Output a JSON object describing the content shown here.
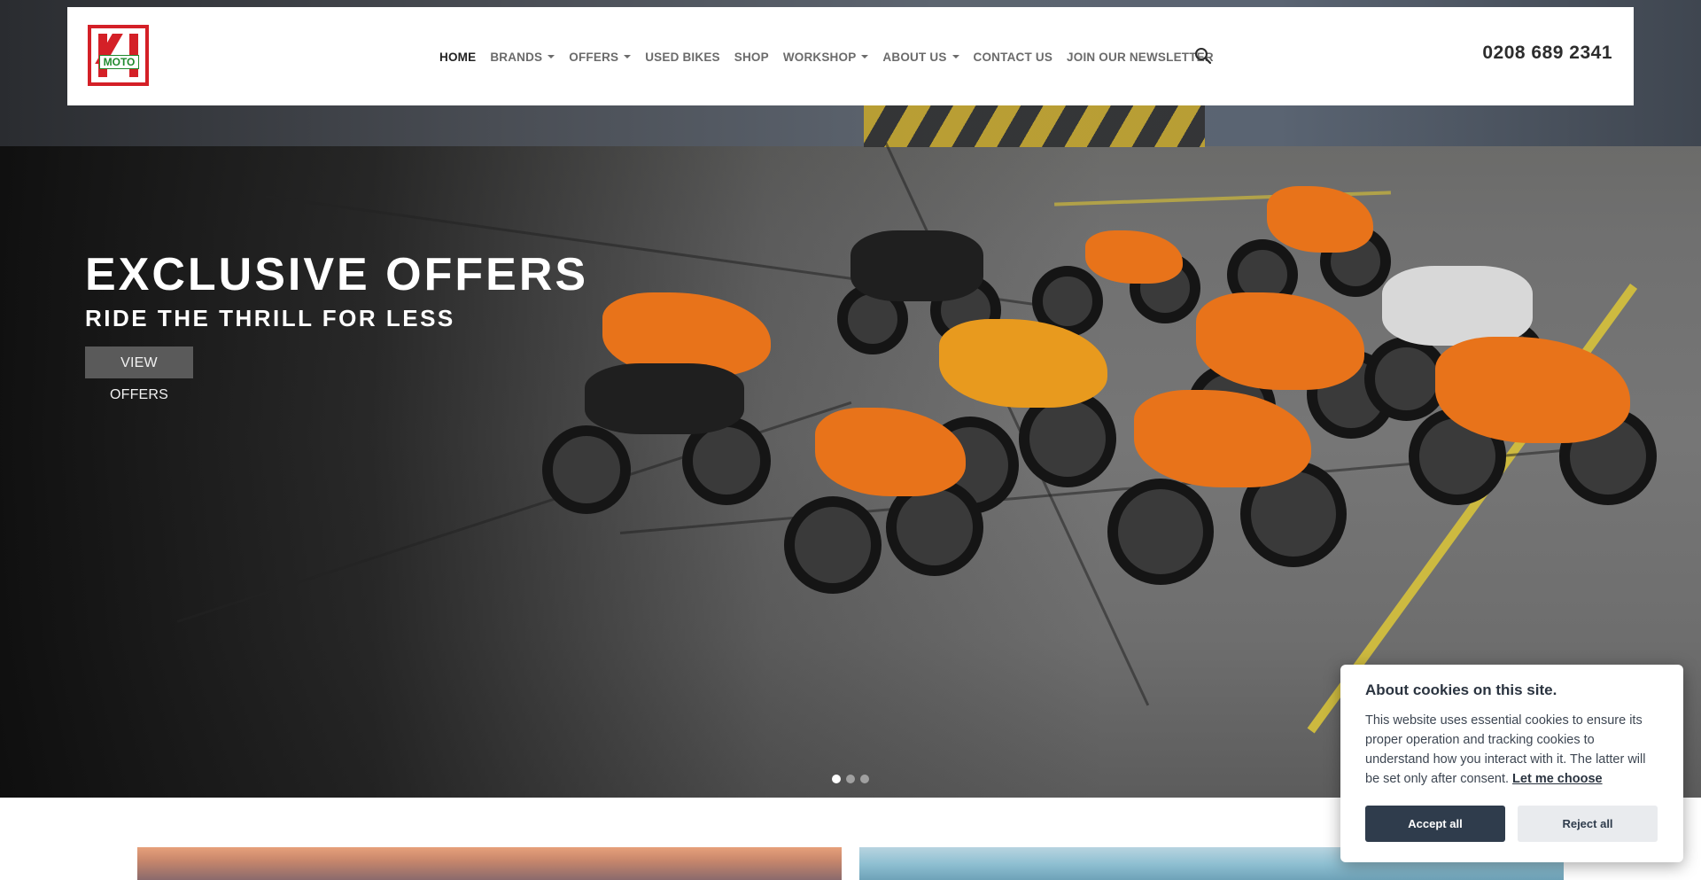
{
  "header": {
    "logo_text": "MOTO",
    "nav": [
      {
        "label": "HOME",
        "active": true,
        "dropdown": false
      },
      {
        "label": "BRANDS",
        "active": false,
        "dropdown": true
      },
      {
        "label": "OFFERS",
        "active": false,
        "dropdown": true
      },
      {
        "label": "USED BIKES",
        "active": false,
        "dropdown": false
      },
      {
        "label": "SHOP",
        "active": false,
        "dropdown": false
      },
      {
        "label": "WORKSHOP",
        "active": false,
        "dropdown": true
      },
      {
        "label": "ABOUT US",
        "active": false,
        "dropdown": true
      },
      {
        "label": "CONTACT US",
        "active": false,
        "dropdown": false
      },
      {
        "label": "JOIN OUR NEWSLETTER",
        "active": false,
        "dropdown": false
      }
    ],
    "search_icon": "search-icon",
    "phone": "0208 689 2341"
  },
  "hero": {
    "title": "EXCLUSIVE OFFERS",
    "subtitle": "RIDE THE THRILL FOR LESS",
    "cta_label": "VIEW OFFERS",
    "slides_total": 3,
    "slide_active": 1
  },
  "cookie": {
    "title": "About cookies on this site.",
    "text": "This website uses essential cookies to ensure its proper operation and tracking cookies to understand how you interact with it. The latter will be set only after consent.",
    "link_label": "Let me choose",
    "accept_label": "Accept all",
    "reject_label": "Reject all"
  },
  "colors": {
    "brand_red": "#d42027",
    "brand_green": "#1f8a2e",
    "cookie_primary": "#2f3c4c",
    "accent_orange": "#e8731a"
  }
}
